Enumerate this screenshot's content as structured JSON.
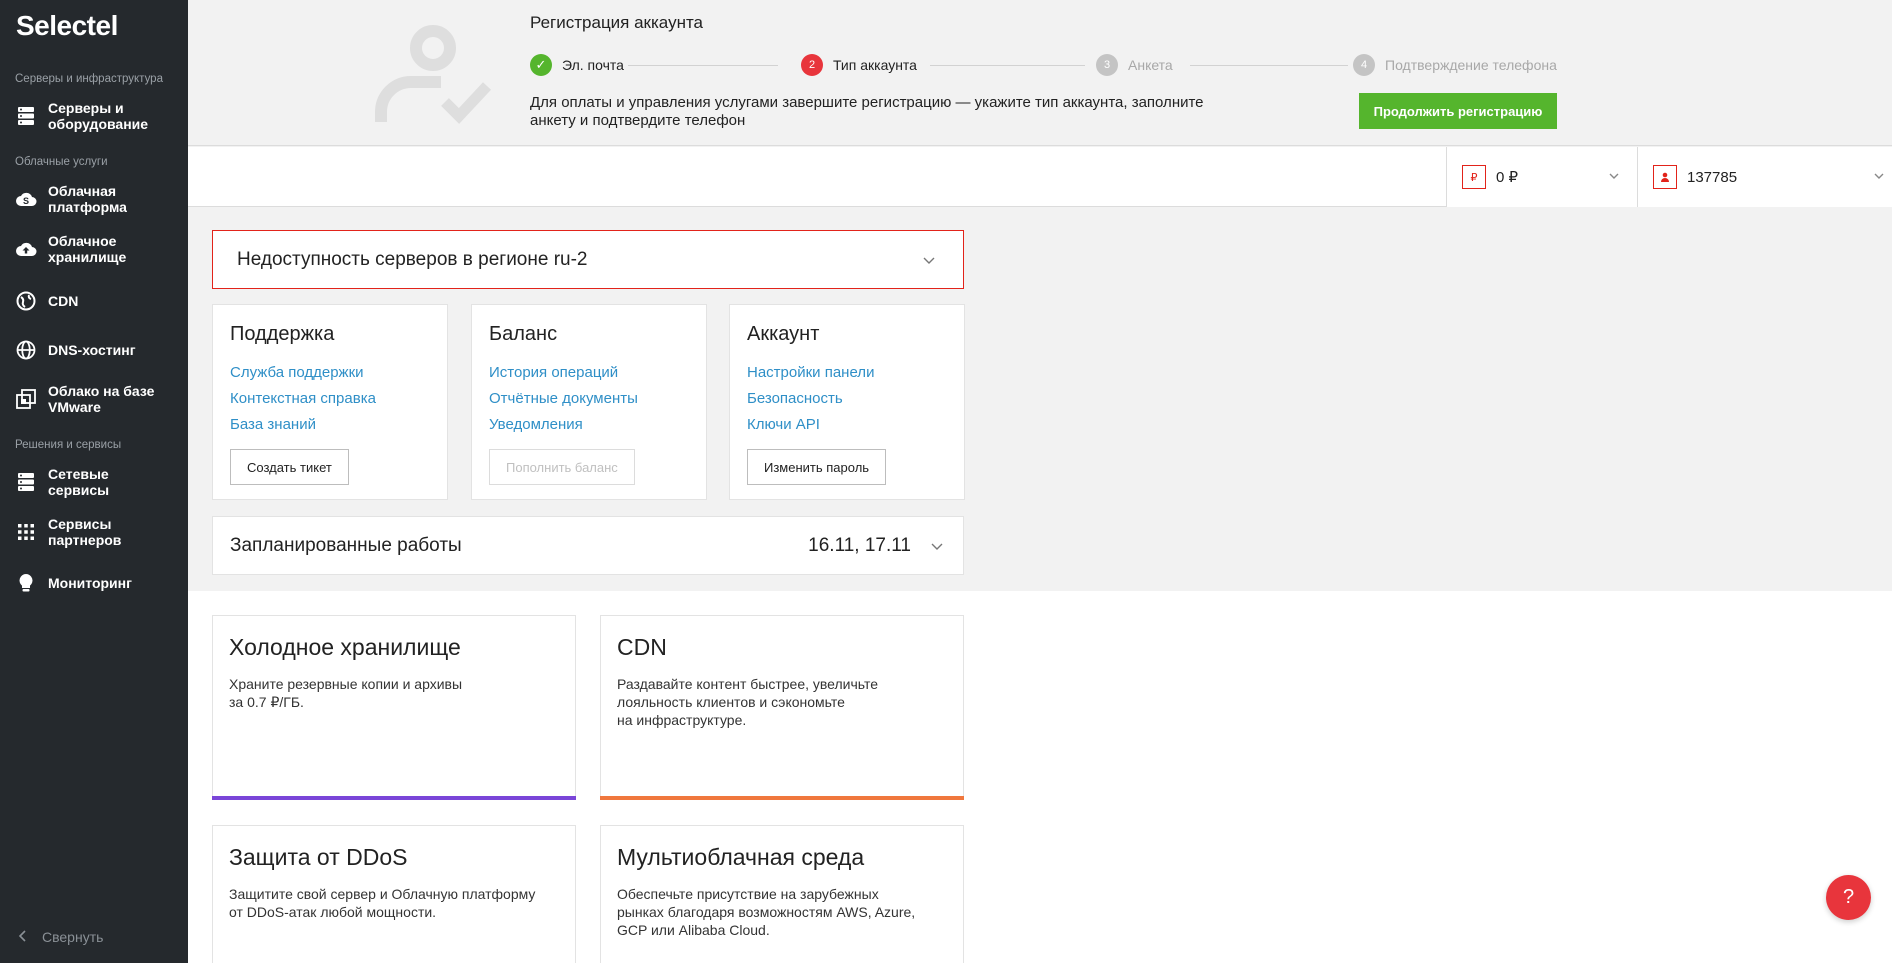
{
  "sidebar": {
    "logo": "Selectel",
    "sections": [
      {
        "title": "Серверы и инфраструктура"
      },
      {
        "title": "Облачные услуги"
      },
      {
        "title": "Решения и сервисы"
      }
    ],
    "items": [
      {
        "label": "Серверы и\nоборудование",
        "icon": "server-icon"
      },
      {
        "label": "Облачная\nплатформа",
        "icon": "cloud-platform-icon"
      },
      {
        "label": "Облачное\nхранилище",
        "icon": "cloud-upload-icon"
      },
      {
        "label": "CDN",
        "icon": "globe-icon"
      },
      {
        "label": "DNS-хостинг",
        "icon": "dns-globe-icon"
      },
      {
        "label": "Облако на базе\nVMware",
        "icon": "vmware-icon"
      },
      {
        "label": "Сетевые\nсервисы",
        "icon": "network-icon"
      },
      {
        "label": "Сервисы\nпартнеров",
        "icon": "grid-icon"
      },
      {
        "label": "Мониторинг",
        "icon": "bulb-icon"
      }
    ],
    "collapse_label": "Свернуть"
  },
  "registration": {
    "title": "Регистрация аккаунта",
    "steps": [
      {
        "num": "✓",
        "label": "Эл. почта",
        "state": "done"
      },
      {
        "num": "2",
        "label": "Тип аккаунта",
        "state": "active"
      },
      {
        "num": "3",
        "label": "Анкета",
        "state": "pending"
      },
      {
        "num": "4",
        "label": "Подтверждение телефона",
        "state": "pending"
      }
    ],
    "description": "Для оплаты и управления услугами завершите регистрацию — укажите тип аккаунта, заполните анкету и подтвердите телефон",
    "continue_button": "Продолжить регистрацию"
  },
  "topbar": {
    "balance_icon": "₽",
    "balance": "0 ₽",
    "account_id": "137785"
  },
  "alert": {
    "text": "Недоступность серверов в регионе ru-2"
  },
  "cards": [
    {
      "title": "Поддержка",
      "links": [
        "Служба поддержки",
        "Контекстная справка",
        "База знаний"
      ],
      "button": "Создать тикет"
    },
    {
      "title": "Баланс",
      "links": [
        "История операций",
        "Отчётные документы",
        "Уведомления"
      ],
      "button": "Пополнить баланс"
    },
    {
      "title": "Аккаунт",
      "links": [
        "Настройки панели",
        "Безопасность",
        "Ключи API"
      ],
      "button": "Изменить пароль"
    }
  ],
  "planned": {
    "title": "Запланированные работы",
    "dates": "16.11, 17.11"
  },
  "promos": [
    {
      "title": "Холодное хранилище",
      "text": "Храните резервные копии и архивы\nза 0.7 ₽/ГБ.",
      "color": "#7a45d8"
    },
    {
      "title": "CDN",
      "text": "Раздавайте контент быстрее, увеличьте\nлояльность клиентов и сэкономьте\nна инфраструктуре.",
      "color": "#f0773d"
    },
    {
      "title": "Защита от DDoS",
      "text": "Защитите свой сервер и Облачную платформу\nот DDoS-атак любой мощности.",
      "color": ""
    },
    {
      "title": "Мультиоблачная среда",
      "text": "Обеспечьте присутствие на зарубежных\nрынках благодаря возможностям AWS, Azure,\nGCP или Alibaba Cloud.",
      "color": ""
    }
  ],
  "help_label": "?",
  "colors": {
    "sidebar_bg": "#25292d",
    "accent_red": "#e8353c",
    "green": "#55b52d",
    "link_blue": "#2f8fc7"
  }
}
